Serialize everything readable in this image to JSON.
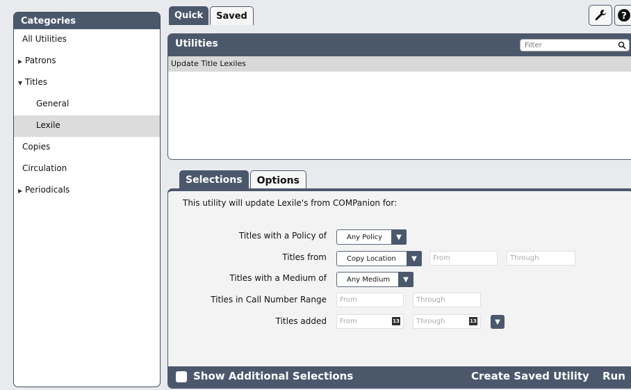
{
  "sidebar": {
    "header": "Categories",
    "items": [
      {
        "label": "All Utilities",
        "arrow": ""
      },
      {
        "label": "Patrons",
        "arrow": "▶"
      },
      {
        "label": "Titles",
        "arrow": "▼"
      },
      {
        "label": "General",
        "arrow": ""
      },
      {
        "label": "Lexile",
        "arrow": ""
      },
      {
        "label": "Copies",
        "arrow": ""
      },
      {
        "label": "Circulation",
        "arrow": ""
      },
      {
        "label": "Periodicals",
        "arrow": "▶"
      }
    ]
  },
  "top_tabs": {
    "quick": "Quick",
    "saved": "Saved"
  },
  "toolbar": {
    "wrench_icon": "wrench-icon",
    "help_icon": "help-icon"
  },
  "utilities": {
    "title": "Utilities",
    "filter_placeholder": "Filter",
    "rows": [
      "Update Title Lexiles"
    ]
  },
  "sel_tabs": {
    "selections": "Selections",
    "options": "Options"
  },
  "selections": {
    "intro": "This utility will update Lexile's from COMPanion for:",
    "policy_label": "Titles with a Policy of",
    "policy_value": "Any Policy",
    "from_label": "Titles from",
    "from_value": "Copy Location",
    "from_placeholder": "From",
    "through_placeholder": "Through",
    "medium_label": "Titles with a Medium of",
    "medium_value": "Any Medium",
    "callnum_label": "Titles in Call Number Range",
    "callnum_from": "From",
    "callnum_through": "Through",
    "added_label": "Titles added",
    "added_from": "From",
    "added_through": "Through",
    "calendar_glyph": "13"
  },
  "footer": {
    "show_additional": "Show Additional Selections",
    "create_saved": "Create Saved Utility",
    "run": "Run"
  }
}
